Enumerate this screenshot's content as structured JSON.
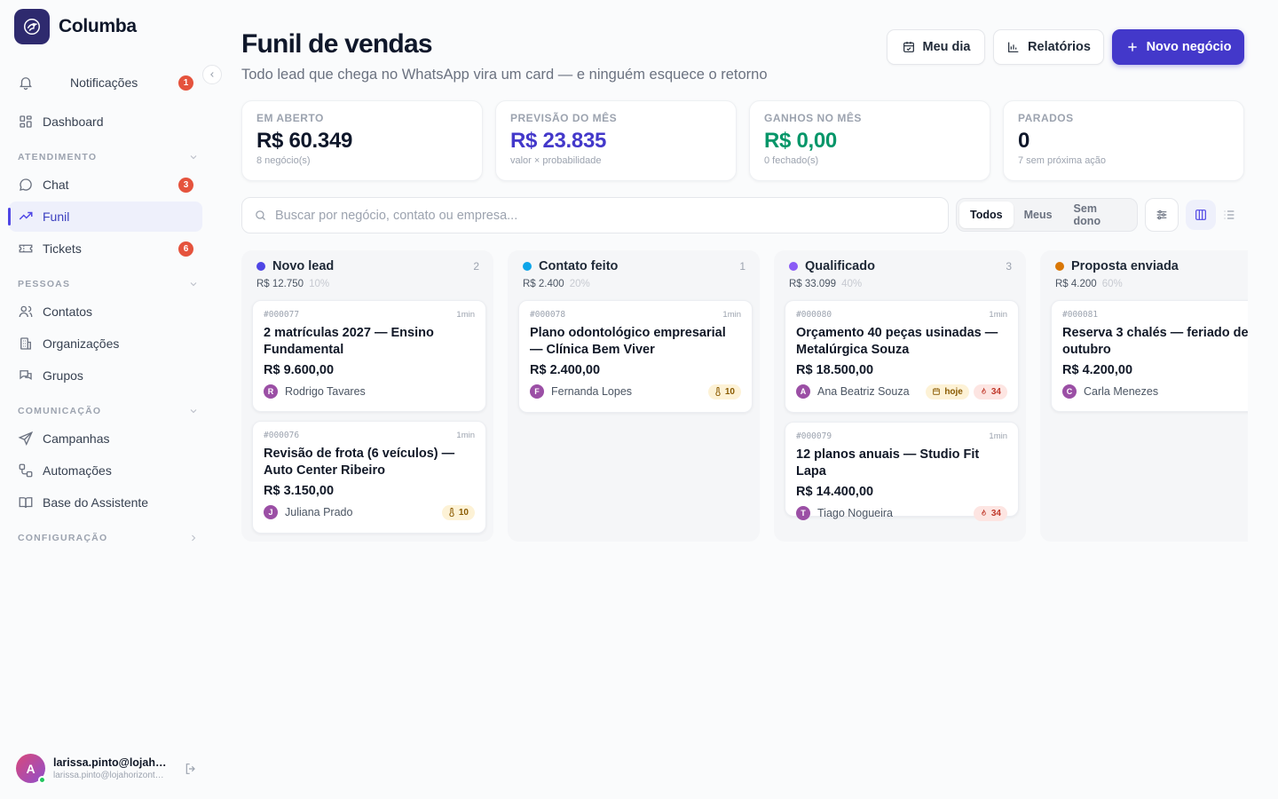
{
  "brand": {
    "name": "Columba"
  },
  "sidebar": {
    "notifications": {
      "label": "Notificações",
      "badge": "1"
    },
    "dashboard": "Dashboard",
    "sections": {
      "atendimento": "ATENDIMENTO",
      "pessoas": "PESSOAS",
      "comunicacao": "COMUNICAÇÃO",
      "configuracao": "CONFIGURAÇÃO"
    },
    "chat": {
      "label": "Chat",
      "badge": "3"
    },
    "funil": {
      "label": "Funil"
    },
    "tickets": {
      "label": "Tickets",
      "badge": "6"
    },
    "contatos": "Contatos",
    "organizacoes": "Organizações",
    "grupos": "Grupos",
    "campanhas": "Campanhas",
    "automacoes": "Automações",
    "base": "Base do Assistente"
  },
  "user": {
    "initial": "A",
    "name": "larissa.pinto@lojahorizonte.com.br",
    "email": "larissa.pinto@lojahorizonte.com.br"
  },
  "header": {
    "title": "Funil de vendas",
    "subtitle": "Todo lead que chega no WhatsApp vira um card — e ninguém esquece o retorno",
    "my_day": "Meu dia",
    "reports": "Relatórios",
    "new_deal": "Novo negócio"
  },
  "stats": {
    "open": {
      "label": "EM ABERTO",
      "value": "R$ 60.349",
      "sub": "8 negócio(s)"
    },
    "forecast": {
      "label": "PREVISÃO DO MÊS",
      "value": "R$ 23.835",
      "sub": "valor × probabilidade"
    },
    "won": {
      "label": "GANHOS NO MÊS",
      "value": "R$ 0,00",
      "sub": "0 fechado(s)"
    },
    "stalled": {
      "label": "PARADOS",
      "value": "0",
      "sub": "7 sem próxima ação"
    }
  },
  "search": {
    "placeholder": "Buscar por negócio, contato ou empresa..."
  },
  "filters": {
    "all": "Todos",
    "mine": "Meus",
    "unowned": "Sem dono"
  },
  "colors": {
    "accent": "#4338ca",
    "won": "#059669",
    "novo": "#4f46e5",
    "contato": "#0ea5e9",
    "qualificado": "#8b5cf6",
    "proposta": "#d97706"
  },
  "columns": [
    {
      "title": "Novo lead",
      "count": "2",
      "total": "R$ 12.750",
      "prob": "10%",
      "cards": [
        {
          "code": "#000077",
          "age": "1min",
          "title": "2 matrículas 2027 — Ensino Fundamental",
          "value": "R$ 9.600,00",
          "initial": "R",
          "owner": "Rodrigo Tavares"
        },
        {
          "code": "#000076",
          "age": "1min",
          "title": "Revisão de frota (6 veículos) — Auto Center Ribeiro",
          "value": "R$ 3.150,00",
          "initial": "J",
          "owner": "Juliana Prado",
          "chip": "10"
        }
      ]
    },
    {
      "title": "Contato feito",
      "count": "1",
      "total": "R$ 2.400",
      "prob": "20%",
      "cards": [
        {
          "code": "#000078",
          "age": "1min",
          "title": "Plano odontológico empresarial — Clínica Bem Viver",
          "value": "R$ 2.400,00",
          "initial": "F",
          "owner": "Fernanda Lopes",
          "chip": "10"
        }
      ]
    },
    {
      "title": "Qualificado",
      "count": "3",
      "total": "R$ 33.099",
      "prob": "40%",
      "cards": [
        {
          "code": "#000080",
          "age": "1min",
          "title": "Orçamento 40 peças usinadas — Metalúrgica Souza",
          "value": "R$ 18.500,00",
          "initial": "A",
          "owner": "Ana Beatriz Souza",
          "chip_today": "hoje",
          "chip": "34"
        },
        {
          "code": "#000079",
          "age": "1min",
          "title": "12 planos anuais — Studio Fit Lapa",
          "value": "R$ 14.400,00",
          "initial": "T",
          "owner": "Tiago Nogueira",
          "chip": "34"
        }
      ]
    },
    {
      "title": "Proposta enviada",
      "count": "",
      "total": "R$ 4.200",
      "prob": "60%",
      "cards": [
        {
          "code": "#000081",
          "age": "",
          "title": "Reserva 3 chalés — feriado de outubro",
          "value": "R$ 4.200,00",
          "initial": "C",
          "owner": "Carla Menezes"
        }
      ]
    }
  ]
}
